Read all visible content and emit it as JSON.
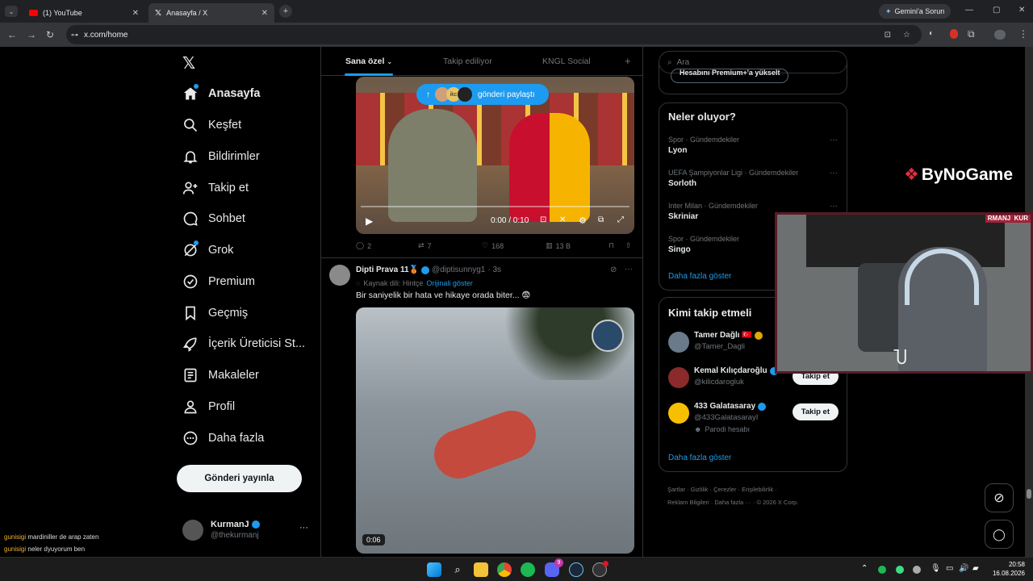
{
  "browser": {
    "tabs": [
      {
        "title": "(1) YouTube",
        "active": false
      },
      {
        "title": "Anasayfa / X",
        "active": true
      }
    ],
    "gemini_label": "Gemini'a Sorun",
    "url": "x.com/home"
  },
  "sidebar": {
    "items": [
      {
        "label": "Anasayfa",
        "icon": "home-icon",
        "bold": true
      },
      {
        "label": "Keşfet",
        "icon": "search-icon"
      },
      {
        "label": "Bildirimler",
        "icon": "bell-icon"
      },
      {
        "label": "Takip et",
        "icon": "person-add-icon"
      },
      {
        "label": "Sohbet",
        "icon": "chat-icon"
      },
      {
        "label": "Grok",
        "icon": "grok-icon"
      },
      {
        "label": "Premium",
        "icon": "premium-icon"
      },
      {
        "label": "Geçmiş",
        "icon": "bookmark-icon"
      },
      {
        "label": "İçerik Üreticisi St...",
        "icon": "rocket-icon"
      },
      {
        "label": "Makaleler",
        "icon": "article-icon"
      },
      {
        "label": "Profil",
        "icon": "profile-icon"
      },
      {
        "label": "Daha fazla",
        "icon": "more-circle-icon"
      }
    ],
    "post_button": "Gönderi yayınla",
    "account": {
      "name": "KurmanJ",
      "handle": "@thekurmanj"
    }
  },
  "feed": {
    "tabs": [
      "Sana özel",
      "Takip ediliyor",
      "KNGL Social"
    ],
    "share_pill": "gönderi paylaştı",
    "share_avatar_text": "ikc",
    "post1": {
      "video_time": "0:00 / 0:10",
      "replies": "2",
      "reposts": "7",
      "likes": "168",
      "views": "13 B"
    },
    "post2": {
      "name": "Dipti Prava 11🥉",
      "handle": "@diptisunnyg1",
      "time": "· 3s",
      "source_lang": "Kaynak dili: Hintçe",
      "show_original": "Orijinali göster",
      "text": "Bir saniyelik bir hata ve hikaye orada biter... 😨",
      "video_duration": "0:06"
    }
  },
  "right": {
    "search_placeholder": "Ara",
    "premium_btn": "Hesabını Premium+'a yükselt",
    "whats_happening": {
      "title": "Neler oluyor?",
      "trends": [
        {
          "category": "Spor · Gündemdekiler",
          "name": "Lyon"
        },
        {
          "category": "UEFA Şampiyonlar Ligi · Gündemdekiler",
          "name": "Sorloth"
        },
        {
          "category": "Inter Milan · Gündemdekiler",
          "name": "Skriniar"
        },
        {
          "category": "Spor · Gündemdekiler",
          "name": "Singo"
        }
      ],
      "show_more": "Daha fazla göster"
    },
    "who_to_follow": {
      "title": "Kimi takip etmeli",
      "users": [
        {
          "name": "Tamer Dağlı 🇹🇷",
          "handle": "@Tamer_Dagli",
          "note": ""
        },
        {
          "name": "Kemal Kılıçdaroğlu",
          "handle": "@kilicdarogluk",
          "note": ""
        },
        {
          "name": "433 Galatasaray",
          "handle": "@433GalatasarayI",
          "note": "Parodi hesabı"
        }
      ],
      "follow_label": "Takip et",
      "show_more": "Daha fazla göster"
    },
    "footer": {
      "line1": [
        "Şartlar",
        "Gizlilik",
        "Çerezler",
        "Erişilebilirlik"
      ],
      "line2": [
        "Reklam Bilgileri",
        "Daha fazla ···",
        "© 2026 X Corp."
      ]
    }
  },
  "overlay": {
    "brand": "ByNoGame",
    "ticker": "RMANJ  KUR",
    "chat": [
      {
        "user": "gunisigi",
        "msg": "mardiniller de arap zaten"
      },
      {
        "user": "gunisigi",
        "msg": "neler dyuyorum ben"
      }
    ]
  },
  "taskbar": {
    "time": "20:58",
    "date": "16.08.2026",
    "discord_badge": "9"
  },
  "colors": {
    "accent": "#1d9bf0",
    "bg": "#000000",
    "border": "#2f3336"
  }
}
